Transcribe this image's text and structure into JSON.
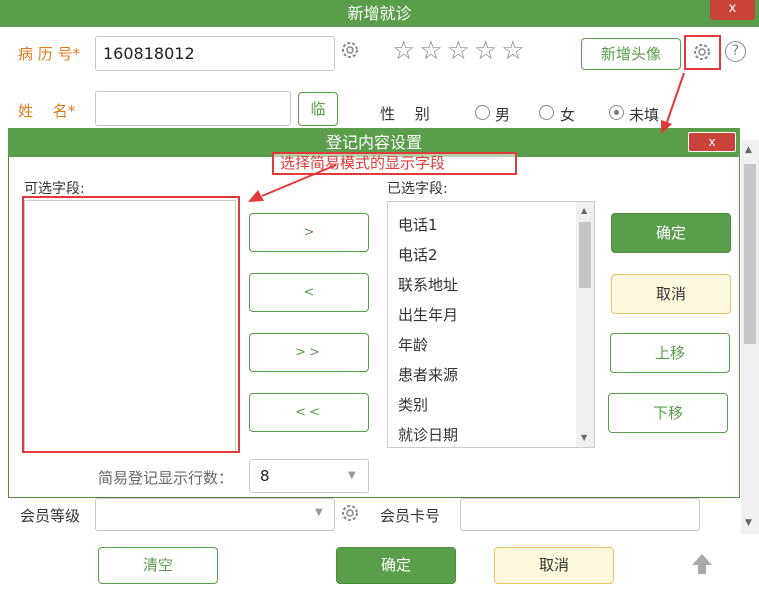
{
  "window": {
    "title": "新增就诊",
    "close": "x"
  },
  "form": {
    "record_no_label": "病 历 号*",
    "record_no_value": "160818012",
    "new_avatar_button": "新增头像",
    "help_icon": "?",
    "name_label": "姓　 名*",
    "temp_button": "临",
    "gender_label": "性　 别",
    "gender_options": [
      "男",
      "女",
      "未填"
    ],
    "member_level_label": "会员等级",
    "member_card_label": "会员卡号"
  },
  "dialog": {
    "title": "登记内容设置",
    "close": "x",
    "annotation": "选择简易模式的显示字段",
    "available_label": "可选字段:",
    "selected_label": "已选字段:",
    "move_buttons": [
      ">",
      "<",
      ">>",
      "<<"
    ],
    "selected_fields": [
      "电话1",
      "电话2",
      "联系地址",
      "出生年月",
      "年龄",
      "患者来源",
      "类别",
      "就诊日期"
    ],
    "confirm": "确定",
    "cancel": "取消",
    "move_up": "上移",
    "move_down": "下移",
    "rows_label": "简易登记显示行数：",
    "rows_value": "8"
  },
  "footer": {
    "clear": "清空",
    "confirm": "确定",
    "cancel": "取消"
  },
  "colors": {
    "accent": "#5a9d4a",
    "close": "#c9433a",
    "highlight": "#e03a3a",
    "label": "#e07b1a"
  }
}
